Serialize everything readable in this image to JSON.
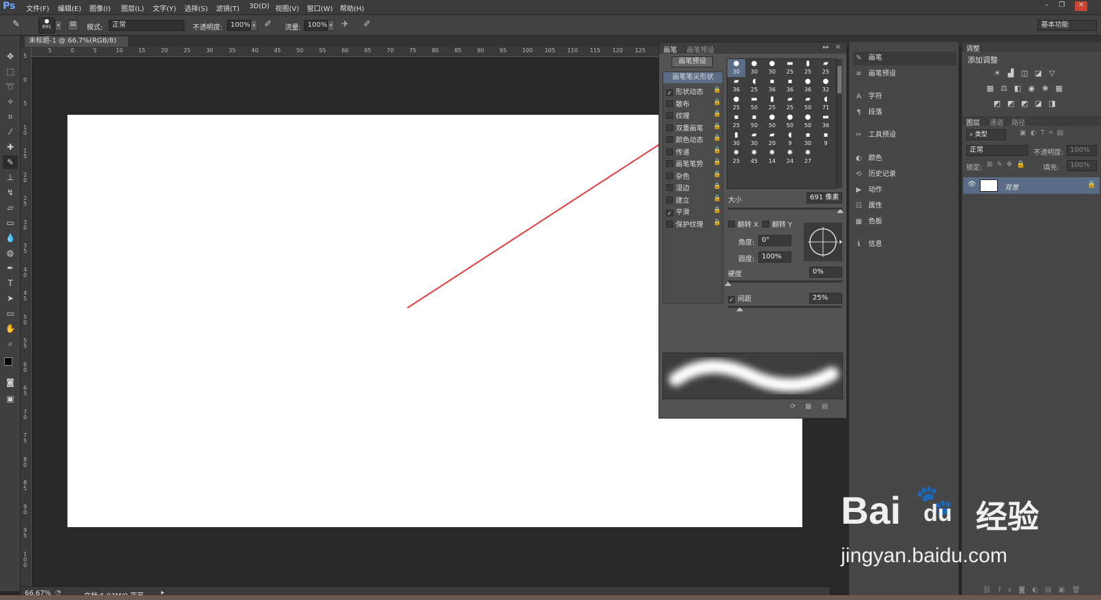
{
  "app": {
    "logo": "Ps",
    "accent": "#6aa6ff",
    "annotation_arrow_color": "#e83a3a"
  },
  "menu": [
    "文件(F)",
    "编辑(E)",
    "图像(I)",
    "图层(L)",
    "文字(Y)",
    "选择(S)",
    "滤镜(T)",
    "3D(D)",
    "视图(V)",
    "窗口(W)",
    "帮助(H)"
  ],
  "window_controls": [
    "–",
    "❐",
    "✕"
  ],
  "options": {
    "brush_size": "691",
    "mode_label": "模式:",
    "mode_value": "正常",
    "opacity_label": "不透明度:",
    "opacity_value": "100%",
    "flow_label": "流量:",
    "flow_value": "100%",
    "workspace": "基本功能"
  },
  "document": {
    "tab_title": "未标题-1 @ 66.7%(RGB/8)",
    "zoom": "66.67%",
    "doc_info": "文档:5.93M/0 字节"
  },
  "ruler_h": [
    "5",
    "0",
    "5",
    "10",
    "15",
    "20",
    "25",
    "30",
    "35",
    "40",
    "45",
    "50",
    "55",
    "60",
    "65",
    "70",
    "75",
    "80",
    "85",
    "90",
    "95",
    "100",
    "105",
    "110",
    "115",
    "120",
    "125"
  ],
  "ruler_v": [
    "5",
    "0",
    "5",
    "1 0",
    "1 5",
    "2 0",
    "2 5",
    "3 0",
    "3 5",
    "4 0",
    "4 5",
    "5 0",
    "5 5",
    "6 0",
    "6 5",
    "7 0",
    "7 5",
    "8 0",
    "8 5",
    "9 0",
    "9 5",
    "1 0 0"
  ],
  "brush_panel": {
    "tabs": [
      "画笔",
      "画笔预设"
    ],
    "preset_button": "画笔预设",
    "section_header": "画笔笔尖形状",
    "options": [
      {
        "label": "形状动态",
        "checked": true
      },
      {
        "label": "散布",
        "checked": false
      },
      {
        "label": "纹理",
        "checked": false
      },
      {
        "label": "双重画笔",
        "checked": false
      },
      {
        "label": "颜色动态",
        "checked": false
      },
      {
        "label": "传递",
        "checked": false
      },
      {
        "label": "画笔笔势",
        "checked": false
      },
      {
        "label": "杂色",
        "checked": false
      },
      {
        "label": "湿边",
        "checked": false
      },
      {
        "label": "建立",
        "checked": false
      },
      {
        "label": "平滑",
        "checked": true
      },
      {
        "label": "保护纹理",
        "checked": false
      }
    ],
    "tip_sizes": [
      "30",
      "30",
      "30",
      "25",
      "25",
      "25",
      "36",
      "25",
      "36",
      "36",
      "36",
      "32",
      "25",
      "50",
      "25",
      "25",
      "50",
      "71",
      "25",
      "50",
      "50",
      "50",
      "50",
      "36",
      "30",
      "30",
      "20",
      "9",
      "30",
      "9",
      "25",
      "45",
      "14",
      "24",
      "27"
    ],
    "size_label": "大小",
    "size_value": "691 像素",
    "flip_x": "翻转 X",
    "flip_y": "翻转 Y",
    "angle_label": "角度:",
    "angle_value": "0°",
    "roundness_label": "圆度:",
    "roundness_value": "100%",
    "hardness_label": "硬度",
    "hardness_value": "0%",
    "spacing_label": "间距",
    "spacing_value": "25%",
    "size_slider": 0.98,
    "hardness_slider": 0.0,
    "spacing_slider": 0.1
  },
  "mid_panel": {
    "items": [
      {
        "icon": "brush-icon",
        "glyph": "✎",
        "label": "画笔"
      },
      {
        "icon": "brush-preset-icon",
        "glyph": "≡",
        "label": "画笔预设"
      },
      {
        "icon": "character-icon",
        "glyph": "A",
        "label": "字符"
      },
      {
        "icon": "paragraph-icon",
        "glyph": "¶",
        "label": "段落"
      },
      {
        "icon": "tool-preset-icon",
        "glyph": "✂",
        "label": "工具预设"
      },
      {
        "icon": "color-icon",
        "glyph": "◐",
        "label": "颜色"
      },
      {
        "icon": "history-icon",
        "glyph": "⟲",
        "label": "历史记录"
      },
      {
        "icon": "actions-icon",
        "glyph": "▶",
        "label": "动作"
      },
      {
        "icon": "properties-icon",
        "glyph": "☷",
        "label": "属性"
      },
      {
        "icon": "swatches-icon",
        "glyph": "▦",
        "label": "色板"
      },
      {
        "icon": "info-icon",
        "glyph": "ℹ",
        "label": "信息"
      }
    ]
  },
  "right_panel": {
    "adjust_tab": "调整",
    "add_adjustment": "添加调整",
    "layers_tabs": [
      "图层",
      "通道",
      "路径"
    ],
    "kind_filter": "类型",
    "blend_mode": "正常",
    "opacity_label": "不透明度:",
    "opacity_value": "100%",
    "lock_label": "锁定:",
    "fill_label": "填充:",
    "fill_value": "100%",
    "layer_name": "背景"
  },
  "watermark": {
    "brand": "Bai",
    "brand2": "du",
    "cn": "经验",
    "url": "jingyan.baidu.com"
  }
}
